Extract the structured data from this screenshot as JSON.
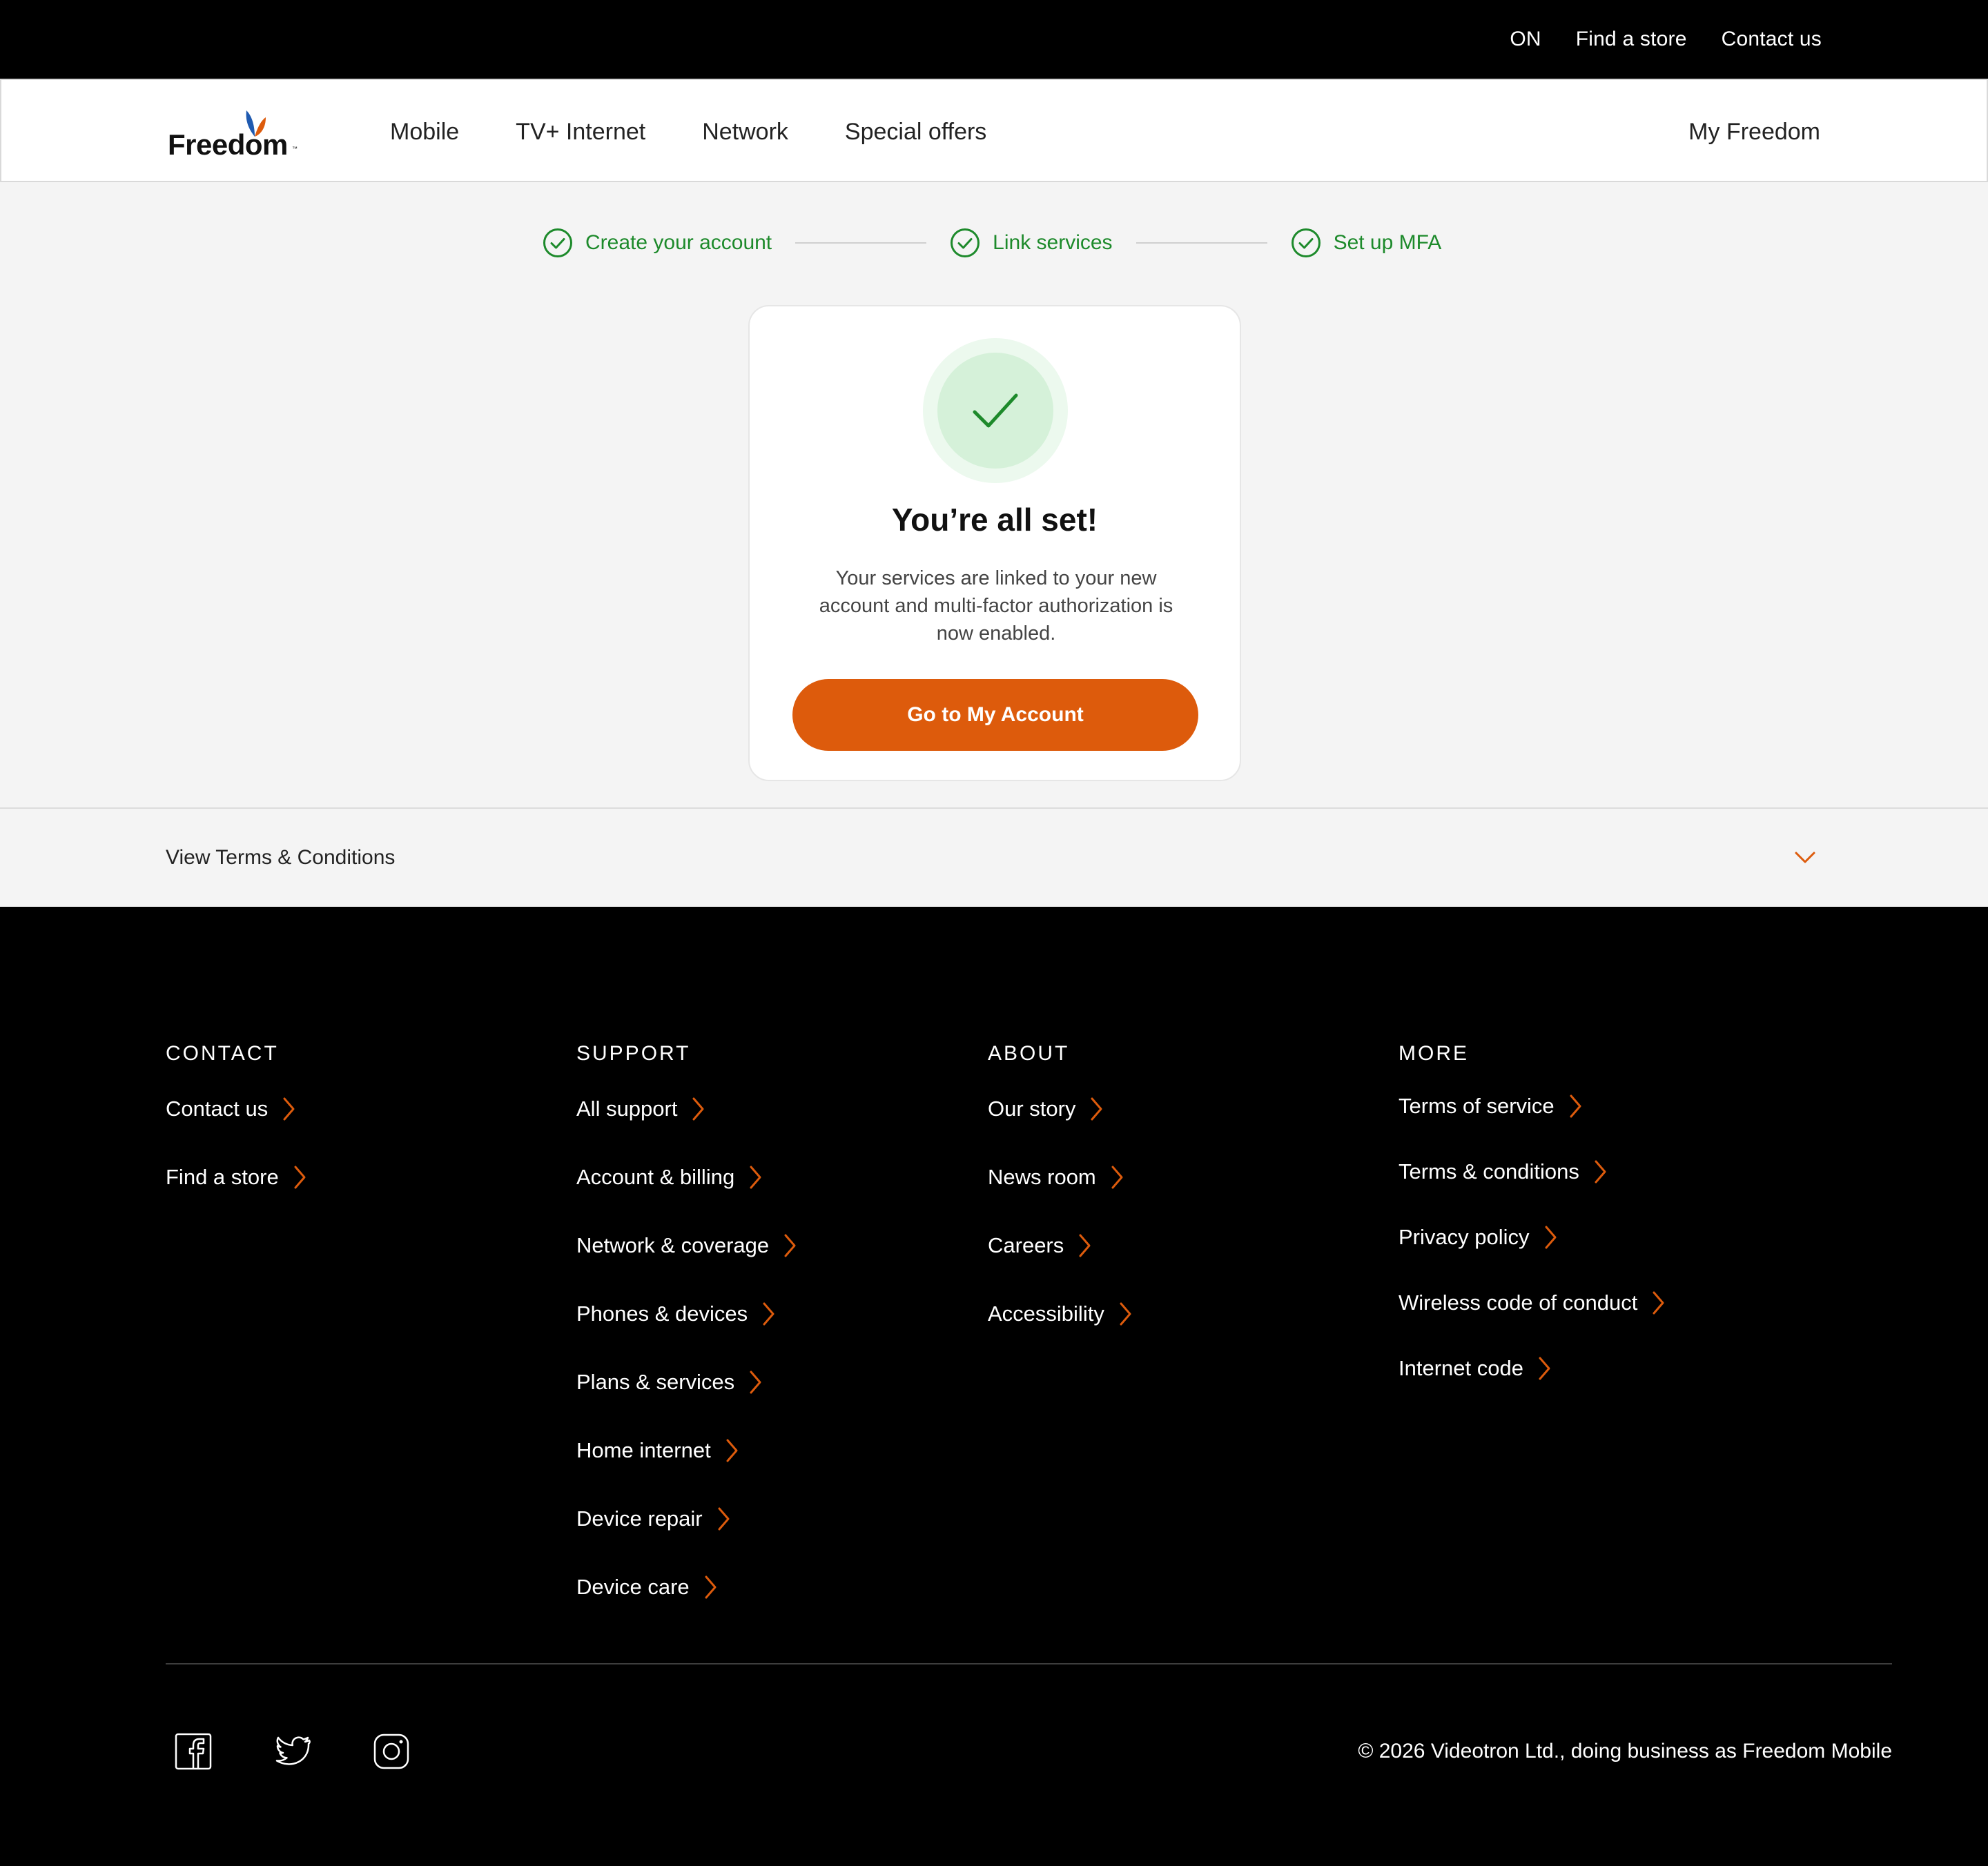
{
  "utility": {
    "region": "ON",
    "find_store": "Find a store",
    "contact": "Contact us"
  },
  "brand": {
    "name": "Freedom",
    "trademark": "™",
    "accent_orange": "#dd5b0c",
    "accent_blue": "#1f5ab0",
    "success_green": "#1d8a2b"
  },
  "nav": {
    "items": [
      {
        "label": "Mobile"
      },
      {
        "label": "TV+ Internet"
      },
      {
        "label": "Network"
      },
      {
        "label": "Special offers"
      }
    ],
    "account": "My Freedom"
  },
  "stepper": {
    "steps": [
      {
        "label": "Create your account",
        "status": "complete"
      },
      {
        "label": "Link services",
        "status": "complete"
      },
      {
        "label": "Set up MFA",
        "status": "complete"
      }
    ]
  },
  "card": {
    "icon": "check-icon",
    "title": "You’re all set!",
    "body": "Your services are linked to your new account and multi-factor authorization is now enabled.",
    "cta": "Go to My Account"
  },
  "terms": {
    "label": "View Terms & Conditions",
    "icon": "chevron-down-icon"
  },
  "footer": {
    "columns": [
      {
        "heading": "CONTACT",
        "links": [
          "Contact us",
          "Find a store"
        ]
      },
      {
        "heading": "SUPPORT",
        "links": [
          "All support",
          "Account & billing",
          "Network & coverage",
          "Phones & devices",
          "Plans & services",
          "Home internet",
          "Device repair",
          "Device care"
        ]
      },
      {
        "heading": "ABOUT",
        "links": [
          "Our story",
          "News room",
          "Careers",
          "Accessibility"
        ]
      },
      {
        "heading": "MORE",
        "links": [
          "Terms of service",
          "Terms & conditions",
          "Privacy policy",
          "Wireless code of conduct",
          "Internet code"
        ]
      }
    ],
    "social": [
      "facebook-icon",
      "twitter-icon",
      "instagram-icon"
    ],
    "copyright": "© 2026 Videotron Ltd., doing business as Freedom Mobile"
  }
}
